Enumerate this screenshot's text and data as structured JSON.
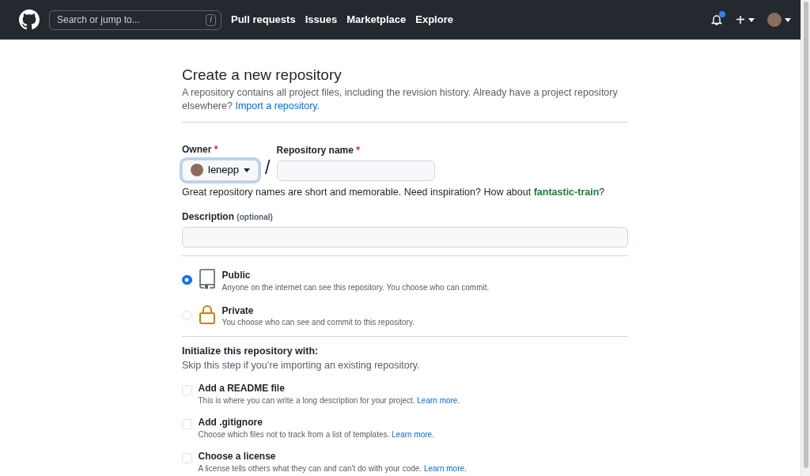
{
  "header": {
    "search": {
      "placeholder": "Search or jump to...",
      "shortcut": "/"
    },
    "nav": [
      "Pull requests",
      "Issues",
      "Marketplace",
      "Explore"
    ],
    "notifications": {
      "unread": true
    },
    "create_menu": "+"
  },
  "page": {
    "title": "Create a new repository",
    "intro": "A repository contains all project files, including the revision history. Already have a project repository elsewhere?",
    "intro_link": "Import a repository.",
    "owner": {
      "label": "Owner",
      "required_mark": "*",
      "value": "lenepp"
    },
    "separator": "/",
    "repo_name": {
      "label": "Repository name",
      "required_mark": "*"
    },
    "hint": {
      "text": "Great repository names are short and memorable. Need inspiration? How about",
      "suggestion": "fantastic-train",
      "end": "?"
    },
    "description": {
      "label": "Description",
      "note": "(optional)"
    },
    "visibility": [
      {
        "kind": "public",
        "label": "Public",
        "description": "Anyone on the internet can see this repository. You choose who can commit.",
        "selected": true
      },
      {
        "kind": "private",
        "label": "Private",
        "description": "You choose who can see and commit to this repository.",
        "selected": false
      }
    ],
    "init": {
      "heading": "Initialize this repository with:",
      "subtext": "Skip this step if you’re importing an existing repository.",
      "options": [
        {
          "label": "Add a README file",
          "description": "This is where you can write a long description for your project.",
          "link": "Learn more.",
          "checked": false
        },
        {
          "label": "Add .gitignore",
          "description": "Choose which files not to track from a list of templates.",
          "link": "Learn more.",
          "checked": false
        },
        {
          "label": "Choose a license",
          "description": "A license tells others what they can and can't do with your code.",
          "link": "Learn more.",
          "checked": false
        }
      ]
    }
  }
}
